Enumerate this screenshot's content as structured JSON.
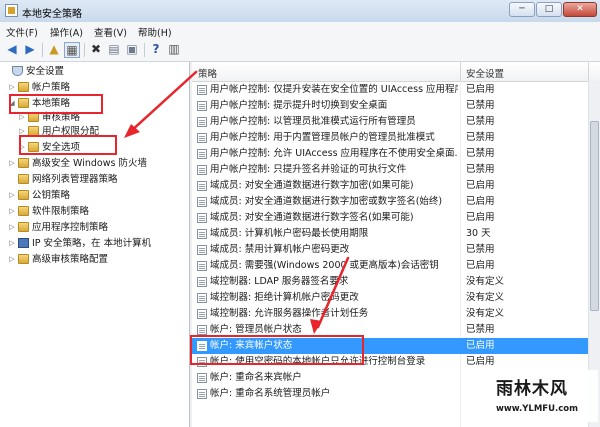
{
  "window": {
    "title": "本地安全策略",
    "controls": {
      "minimize": "─",
      "maximize": "□",
      "close": "✕"
    }
  },
  "menu": [
    "文件(F)",
    "操作(A)",
    "查看(V)",
    "帮助(H)"
  ],
  "toolbar": {
    "icons": [
      "back-icon",
      "forward-icon",
      "up-folder-icon",
      "show-tree-icon",
      "delete-icon",
      "properties-icon",
      "export-icon",
      "help-icon",
      "panel-icon"
    ]
  },
  "tree": [
    {
      "label": "安全设置",
      "expander": "",
      "icon": "shield"
    },
    {
      "label": "帐户策略",
      "expander": "▷",
      "icon": "folder"
    },
    {
      "label": "本地策略",
      "expander": "◢",
      "icon": "folder"
    },
    {
      "label": "审核策略",
      "expander": "▷",
      "icon": "folder"
    },
    {
      "label": "用户权限分配",
      "expander": "▷",
      "icon": "folder"
    },
    {
      "label": "安全选项",
      "expander": "▷",
      "icon": "folder"
    },
    {
      "label": "高级安全 Windows 防火墙",
      "expander": "▷",
      "icon": "folder"
    },
    {
      "label": "网络列表管理器策略",
      "expander": "",
      "icon": "folder"
    },
    {
      "label": "公钥策略",
      "expander": "▷",
      "icon": "folder"
    },
    {
      "label": "软件限制策略",
      "expander": "▷",
      "icon": "folder"
    },
    {
      "label": "应用程序控制策略",
      "expander": "▷",
      "icon": "folder"
    },
    {
      "label": "IP 安全策略，在 本地计算机",
      "expander": "▷",
      "icon": "monitor"
    },
    {
      "label": "高级审核策略配置",
      "expander": "▷",
      "icon": "folder"
    }
  ],
  "columns": {
    "policy": "策略",
    "setting": "安全设置"
  },
  "policies": [
    {
      "name": "用户帐户控制: 仅提升安装在安全位置的 UIAccess 应用程序",
      "setting": "已启用"
    },
    {
      "name": "用户帐户控制: 提示提升时切换到安全桌面",
      "setting": "已禁用"
    },
    {
      "name": "用户帐户控制: 以管理员批准模式运行所有管理员",
      "setting": "已禁用"
    },
    {
      "name": "用户帐户控制: 用于内置管理员帐户的管理员批准模式",
      "setting": "已禁用"
    },
    {
      "name": "用户帐户控制: 允许 UIAccess 应用程序在不使用安全桌面...",
      "setting": "已禁用"
    },
    {
      "name": "用户帐户控制: 只提升签名并验证的可执行文件",
      "setting": "已禁用"
    },
    {
      "name": "域成员: 对安全通道数据进行数字加密(如果可能)",
      "setting": "已启用"
    },
    {
      "name": "域成员: 对安全通道数据进行数字加密或数字签名(始终)",
      "setting": "已启用"
    },
    {
      "name": "域成员: 对安全通道数据进行数字签名(如果可能)",
      "setting": "已启用"
    },
    {
      "name": "域成员: 计算机帐户密码最长使用期限",
      "setting": "30 天"
    },
    {
      "name": "域成员: 禁用计算机帐户密码更改",
      "setting": "已禁用"
    },
    {
      "name": "域成员: 需要强(Windows 2000 或更高版本)会话密钥",
      "setting": "已启用"
    },
    {
      "name": "域控制器: LDAP 服务器签名要求",
      "setting": "没有定义"
    },
    {
      "name": "域控制器: 拒绝计算机帐户密码更改",
      "setting": "没有定义"
    },
    {
      "name": "域控制器: 允许服务器操作者计划任务",
      "setting": "没有定义"
    },
    {
      "name": "帐户: 管理员帐户状态",
      "setting": "已禁用"
    },
    {
      "name": "帐户: 来宾帐户状态",
      "setting": "已启用"
    },
    {
      "name": "帐户: 使用空密码的本地帐户只允许进行控制台登录",
      "setting": "已启用"
    },
    {
      "name": "帐户: 重命名来宾帐户",
      "setting": ""
    },
    {
      "name": "帐户: 重命名系统管理员帐户",
      "setting": ""
    }
  ],
  "selected_policy_index": 16,
  "watermark": {
    "brand": "雨林木风",
    "url": "www.YLMFU.com"
  },
  "annotation_color": "#e8242d",
  "selection_color": "#3399ff"
}
